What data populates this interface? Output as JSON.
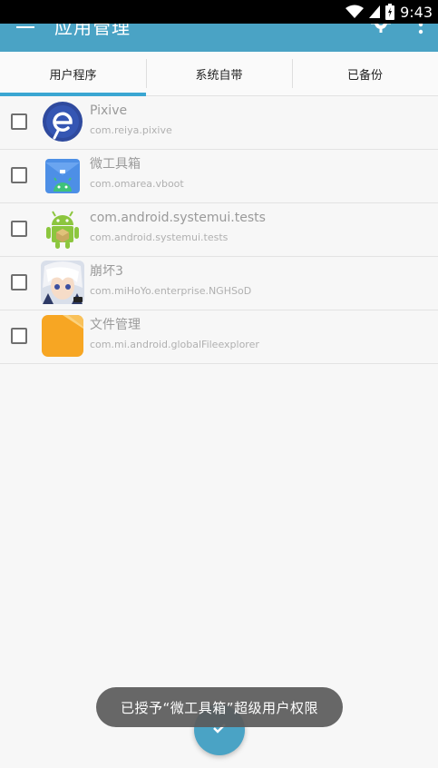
{
  "status_bar": {
    "time": "9:43",
    "icons": [
      "wifi-icon",
      "signal-icon",
      "battery-icon"
    ]
  },
  "app_bar": {
    "title": "应用管理",
    "icons": [
      "menu-icon",
      "gear-icon",
      "overflow-menu-icon"
    ]
  },
  "tabs": [
    {
      "label": "用户程序",
      "active": true
    },
    {
      "label": "系统自带",
      "active": false
    },
    {
      "label": "已备份",
      "active": false
    }
  ],
  "apps": [
    {
      "name": "Pixive",
      "package": "com.reiya.pixive",
      "icon": "pixive-app-icon"
    },
    {
      "name": "微工具箱",
      "package": "com.omarea.vboot",
      "icon": "toolbox-app-icon"
    },
    {
      "name": "com.android.systemui.tests",
      "package": "com.android.systemui.tests",
      "icon": "android-app-icon"
    },
    {
      "name": "崩坏3",
      "package": "com.miHoYo.enterprise.NGHSoD",
      "icon": "honkai-app-icon"
    },
    {
      "name": "文件管理",
      "package": "com.mi.android.globalFileexplorer",
      "icon": "folder-app-icon"
    }
  ],
  "toast": {
    "message": "已授予“微工具箱”超级用户权限"
  },
  "fab": {
    "icon": "check-icon"
  },
  "colors": {
    "accent": "#4aa3c5",
    "tab_indicator": "#3aa6d2",
    "background": "#f7f7f7"
  }
}
